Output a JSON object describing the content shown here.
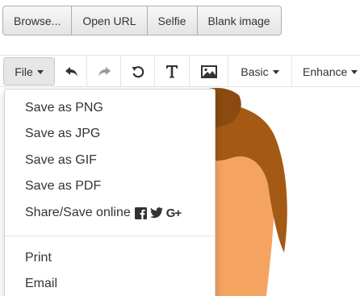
{
  "sources": [
    {
      "label": "Browse..."
    },
    {
      "label": "Open URL"
    },
    {
      "label": "Selfie"
    },
    {
      "label": "Blank image"
    }
  ],
  "toolbar": {
    "file_label": "File",
    "basic_label": "Basic",
    "enhance_label": "Enhance",
    "icons": [
      "undo-icon",
      "redo-icon",
      "rotate-icon",
      "text-icon",
      "image-icon"
    ]
  },
  "file_menu": {
    "items": [
      {
        "label": "Save as PNG"
      },
      {
        "label": "Save as JPG"
      },
      {
        "label": "Save as GIF"
      },
      {
        "label": "Save as PDF"
      },
      {
        "label": "Share/Save online"
      },
      {
        "label": "Print"
      },
      {
        "label": "Email"
      }
    ],
    "social_icons": [
      "facebook-icon",
      "twitter-icon",
      "google-plus-icon"
    ],
    "google_plus_text": "G+"
  },
  "colors": {
    "hair": "#a45a14",
    "hair_shadow": "#8b4a10",
    "skin": "#f4a460"
  }
}
